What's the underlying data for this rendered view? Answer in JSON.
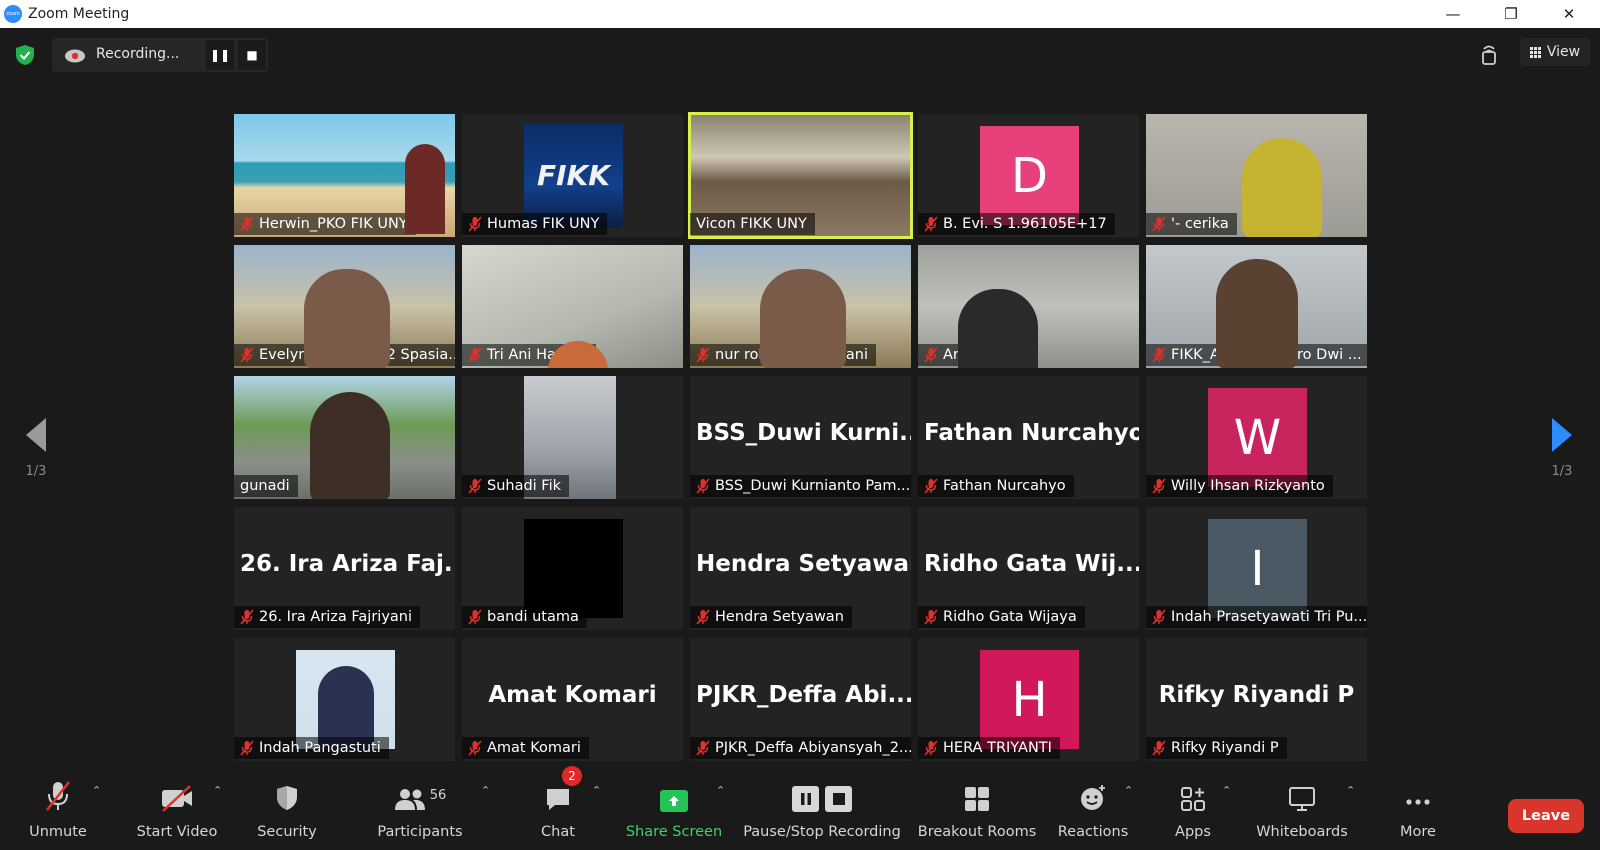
{
  "window": {
    "title": "Zoom Meeting"
  },
  "recording": {
    "status": "Recording..."
  },
  "view_button": {
    "label": "View"
  },
  "page_indicator": {
    "left": "1/3",
    "right": "1/3"
  },
  "tiles": [
    {
      "name": "Herwin_PKO FIK UNY",
      "muted": true,
      "display": "video",
      "bg": "beach"
    },
    {
      "name": "Humas FIK UNY",
      "muted": true,
      "display": "logo",
      "bg": "logo",
      "logo_text": "FIKK"
    },
    {
      "name": "Vicon FIKK UNY",
      "muted": false,
      "display": "video",
      "bg": "room",
      "active_speaker": true
    },
    {
      "name": "B. Evi. S 1.96105E+17",
      "muted": true,
      "display": "avatar",
      "initial": "D",
      "color": "#e8407a"
    },
    {
      "name": "'- cerika",
      "muted": true,
      "display": "video",
      "bg": "hijab"
    },
    {
      "name": "Evelyn Adventa - 2 Spasia...",
      "muted": true,
      "display": "video",
      "bg": "building"
    },
    {
      "name": "Tri Ani Hastuti",
      "muted": true,
      "display": "video",
      "bg": "ceiling"
    },
    {
      "name": "nur rohmah muktiani",
      "muted": true,
      "display": "video",
      "bg": "building"
    },
    {
      "name": "Ari Iswanto",
      "muted": true,
      "display": "video",
      "bg": "office"
    },
    {
      "name": "FIKK_Agus Susworo Dwi ...",
      "muted": true,
      "display": "video",
      "bg": "man"
    },
    {
      "name": "gunadi",
      "muted": false,
      "display": "video",
      "bg": "street"
    },
    {
      "name": "Suhadi Fik",
      "muted": true,
      "display": "car",
      "bg": "car"
    },
    {
      "name": "BSS_Duwi Kurnianto Pam...",
      "muted": true,
      "display": "text",
      "big": "BSS_Duwi  Kurni..."
    },
    {
      "name": "Fathan Nurcahyo",
      "muted": true,
      "display": "text",
      "big": "Fathan Nurcahyo"
    },
    {
      "name": "Willy Ihsan Rizkyanto",
      "muted": true,
      "display": "avatar",
      "initial": "W",
      "color": "#c8245e"
    },
    {
      "name": "26. Ira Ariza Fajriyani",
      "muted": true,
      "display": "text",
      "big": "26. Ira Ariza Faj..."
    },
    {
      "name": "bandi utama",
      "muted": true,
      "display": "black"
    },
    {
      "name": "Hendra Setyawan",
      "muted": true,
      "display": "text",
      "big": "Hendra Setyawan"
    },
    {
      "name": "Ridho Gata Wijaya",
      "muted": true,
      "display": "text",
      "big": "Ridho Gata Wij..."
    },
    {
      "name": "Indah Prasetyawati Tri Pu...",
      "muted": true,
      "display": "avatar",
      "initial": "I",
      "color": "#4a5963"
    },
    {
      "name": "Indah Pangastuti",
      "muted": true,
      "display": "photo"
    },
    {
      "name": "Amat Komari",
      "muted": true,
      "display": "text",
      "big": "Amat Komari"
    },
    {
      "name": "PJKR_Deffa Abiyansyah_2...",
      "muted": true,
      "display": "text",
      "big": "PJKR_Deffa  Abi..."
    },
    {
      "name": "HERA TRIYANTI",
      "muted": true,
      "display": "avatar",
      "initial": "H",
      "color": "#d1185a"
    },
    {
      "name": "Rifky Riyandi P",
      "muted": true,
      "display": "text",
      "big": "Rifky Riyandi P"
    }
  ],
  "toolbar": {
    "unmute": "Unmute",
    "start_video": "Start Video",
    "security": "Security",
    "participants": "Participants",
    "participant_count": "56",
    "chat": "Chat",
    "chat_badge": "2",
    "share_screen": "Share Screen",
    "pause_stop_recording": "Pause/Stop Recording",
    "breakout_rooms": "Breakout Rooms",
    "reactions": "Reactions",
    "apps": "Apps",
    "whiteboards": "Whiteboards",
    "more": "More",
    "leave": "Leave"
  },
  "colors": {
    "share_green": "#25c25a",
    "leave_red": "#d9352a",
    "active_speaker": "#d9f04a",
    "nav_arrow": "#2d8cff"
  }
}
